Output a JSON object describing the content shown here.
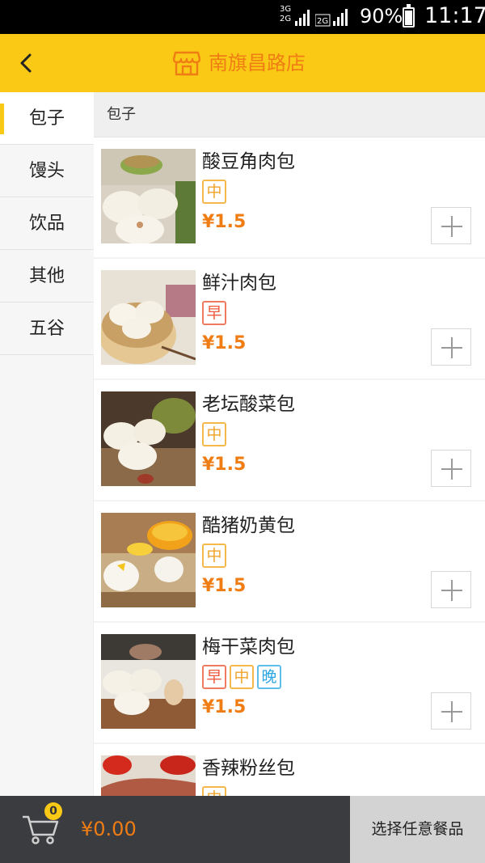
{
  "status_bar": {
    "network_top": "3G",
    "network_bottom": "2G",
    "network_2g": "2G",
    "battery_percent": "90%",
    "time": "11:17"
  },
  "header": {
    "title": "南旗昌路店",
    "back_icon": "chevron-left-icon",
    "store_icon": "storefront-icon"
  },
  "sidebar": {
    "categories": [
      {
        "label": "包子",
        "active": true
      },
      {
        "label": "馒头",
        "active": false
      },
      {
        "label": "饮品",
        "active": false
      },
      {
        "label": "其他",
        "active": false
      },
      {
        "label": "五谷",
        "active": false
      }
    ]
  },
  "section": {
    "title": "包子"
  },
  "products": [
    {
      "name": "酸豆角肉包",
      "tags": [
        "中"
      ],
      "price": "¥1.5"
    },
    {
      "name": "鲜汁肉包",
      "tags": [
        "早"
      ],
      "price": "¥1.5"
    },
    {
      "name": "老坛酸菜包",
      "tags": [
        "中"
      ],
      "price": "¥1.5"
    },
    {
      "name": "酷猪奶黄包",
      "tags": [
        "中"
      ],
      "price": "¥1.5"
    },
    {
      "name": "梅干菜肉包",
      "tags": [
        "早",
        "中",
        "晚"
      ],
      "price": "¥1.5"
    },
    {
      "name": "香辣粉丝包",
      "tags": [
        "中"
      ],
      "price": ""
    }
  ],
  "footer": {
    "cart_count": "0",
    "total": "¥0.00",
    "checkout_label": "选择任意餐品"
  },
  "colors": {
    "accent_yellow": "#f9c916",
    "price_orange": "#f07d14",
    "tag_mid": "#f0a32a",
    "tag_morning": "#ee5a3c",
    "tag_evening": "#2ba5e4"
  }
}
